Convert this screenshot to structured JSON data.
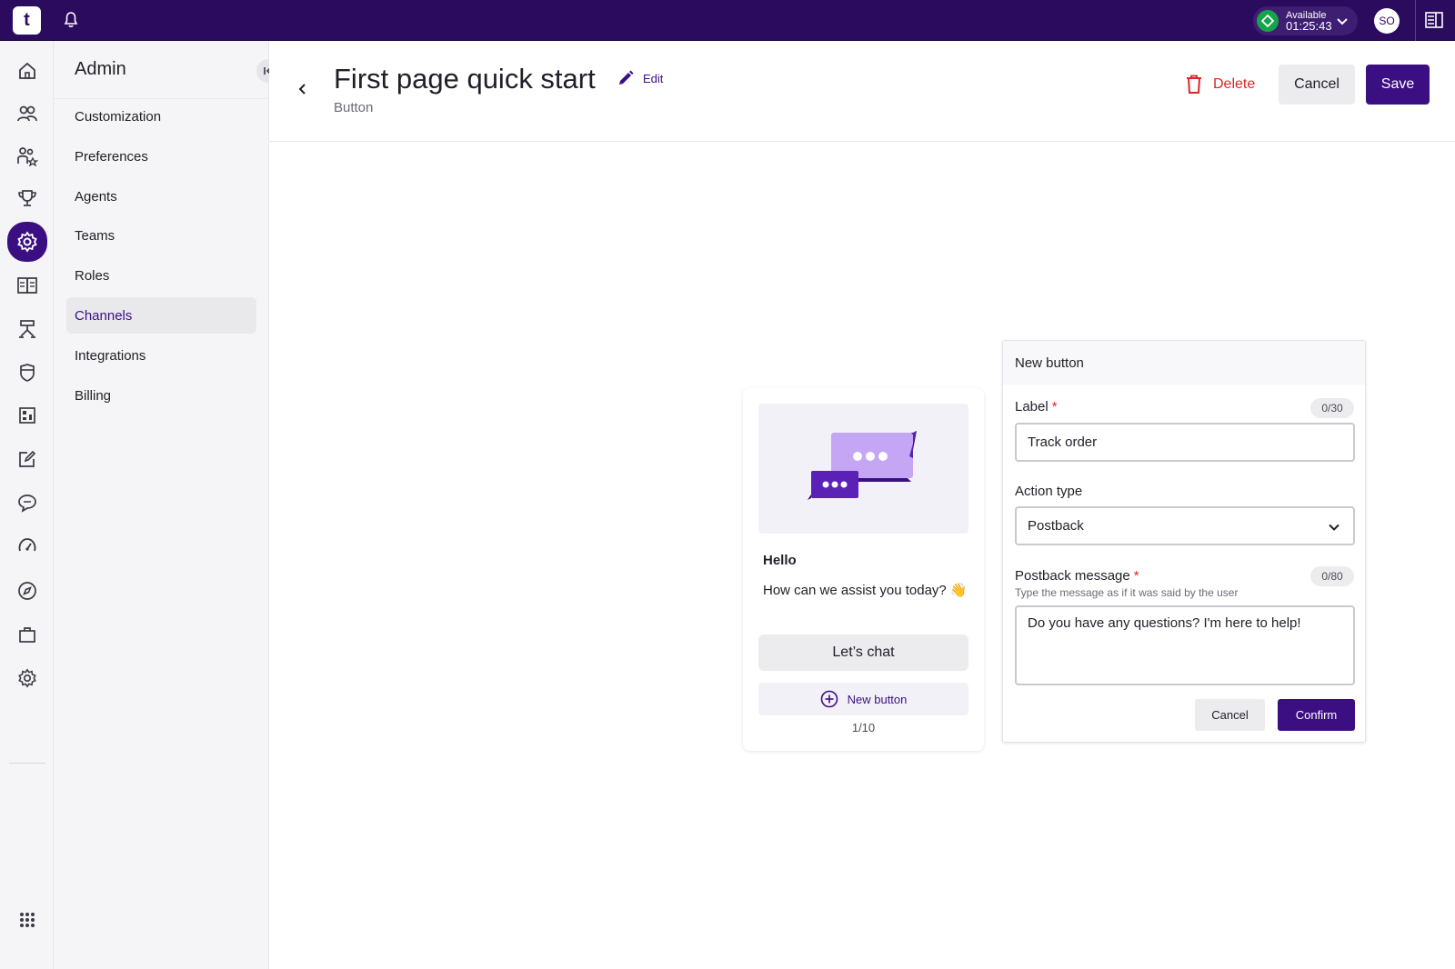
{
  "topbar": {
    "logo_text": "t",
    "status_label": "Available",
    "status_timer": "01:25:43",
    "avatar_initials": "SO",
    "accent": "#2a0b5e"
  },
  "rail": {
    "icons": [
      "home-icon",
      "contacts-icon",
      "teams-icon",
      "trophy-icon",
      "settings-icon",
      "knowledge-book-icon",
      "workflow-icon",
      "shield-icon",
      "reports-icon",
      "edit-note-icon",
      "chat-icon",
      "dashboard-gauge-icon",
      "compass-icon",
      "briefcase-icon",
      "gear-icon",
      "apps-grid-icon"
    ],
    "active": "settings-icon"
  },
  "sidenav": {
    "title": "Admin",
    "items": [
      {
        "label": "Customization"
      },
      {
        "label": "Preferences"
      },
      {
        "label": "Agents"
      },
      {
        "label": "Teams"
      },
      {
        "label": "Roles"
      },
      {
        "label": "Channels"
      },
      {
        "label": "Integrations"
      },
      {
        "label": "Billing"
      }
    ],
    "selected": "Channels"
  },
  "header": {
    "title": "First page quick start",
    "edit_label": "Edit",
    "subtitle": "Button",
    "delete_label": "Delete",
    "cancel_label": "Cancel",
    "save_label": "Save"
  },
  "preview_card": {
    "title": "Hello",
    "body": "How can we assist you today? 👋",
    "chat_button": "Let’s chat",
    "new_button": "New button",
    "counter": "1/10"
  },
  "form": {
    "header": "New button",
    "label_field": {
      "label": "Label",
      "counter": "0/30",
      "value": "Track order"
    },
    "action_field": {
      "label": "Action type",
      "value": "Postback"
    },
    "postback_field": {
      "label": "Postback message",
      "counter": "0/80",
      "hint": "Type the message as if it was said by the user",
      "value": "Do you have any questions? I'm here to help!"
    },
    "cancel_label": "Cancel",
    "confirm_label": "Confirm"
  },
  "colors": {
    "primary": "#3b0f82",
    "danger": "#dc2626",
    "success": "#16a34a"
  }
}
